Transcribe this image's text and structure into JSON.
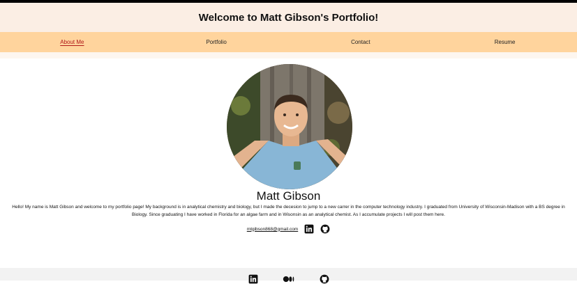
{
  "header": {
    "title": "Welcome to Matt Gibson's Portfolio!"
  },
  "nav": {
    "items": [
      {
        "label": "About Me",
        "active": true
      },
      {
        "label": "Portfolio",
        "active": false
      },
      {
        "label": "Contact",
        "active": false
      },
      {
        "label": "Resume",
        "active": false
      }
    ]
  },
  "profile": {
    "name": "Matt Gibson",
    "bio": "Hello! My name is Matt Gibson and welcome to my portfolio page! My background is in analytical chemistry and biology, but I made the decesion to jump to a new carrer in the computer technology industry. I graduated from University of Wisconsin-Madison with a BS degree in Biology. Since graduating I have worked in Florida for an algae farm and in Wisonsin as an analytical chemist. As I accumulate projects I will post them here.",
    "email": "mtgibson868@gmail.com"
  },
  "icons": {
    "contact": [
      "linkedin-icon",
      "github-icon"
    ],
    "footer": [
      "linkedin-icon",
      "medium-icon",
      "github-icon"
    ]
  },
  "colors": {
    "header_bg": "#fbeee4",
    "nav_bg": "#ffd49d",
    "active_link": "#b01818",
    "footer_bg": "#f2f2f2"
  }
}
